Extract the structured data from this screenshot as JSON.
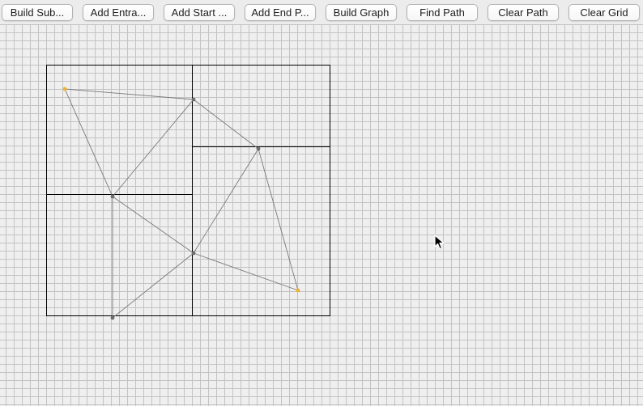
{
  "toolbar": {
    "buttons": [
      {
        "label": "Build Sub..."
      },
      {
        "label": "Add Entra..."
      },
      {
        "label": "Add Start ..."
      },
      {
        "label": "Add End P..."
      },
      {
        "label": "Build Graph"
      },
      {
        "label": "Find Path"
      },
      {
        "label": "Clear Path"
      },
      {
        "label": "Clear Grid"
      }
    ]
  },
  "grid_view": {
    "colors": {
      "background": "#efefef",
      "grid_line": "#c3c3c3",
      "cluster_border": "#000000",
      "edge": "#7a7a7a",
      "node": "#6e6e6e",
      "endpoint": "#f0b030"
    }
  }
}
